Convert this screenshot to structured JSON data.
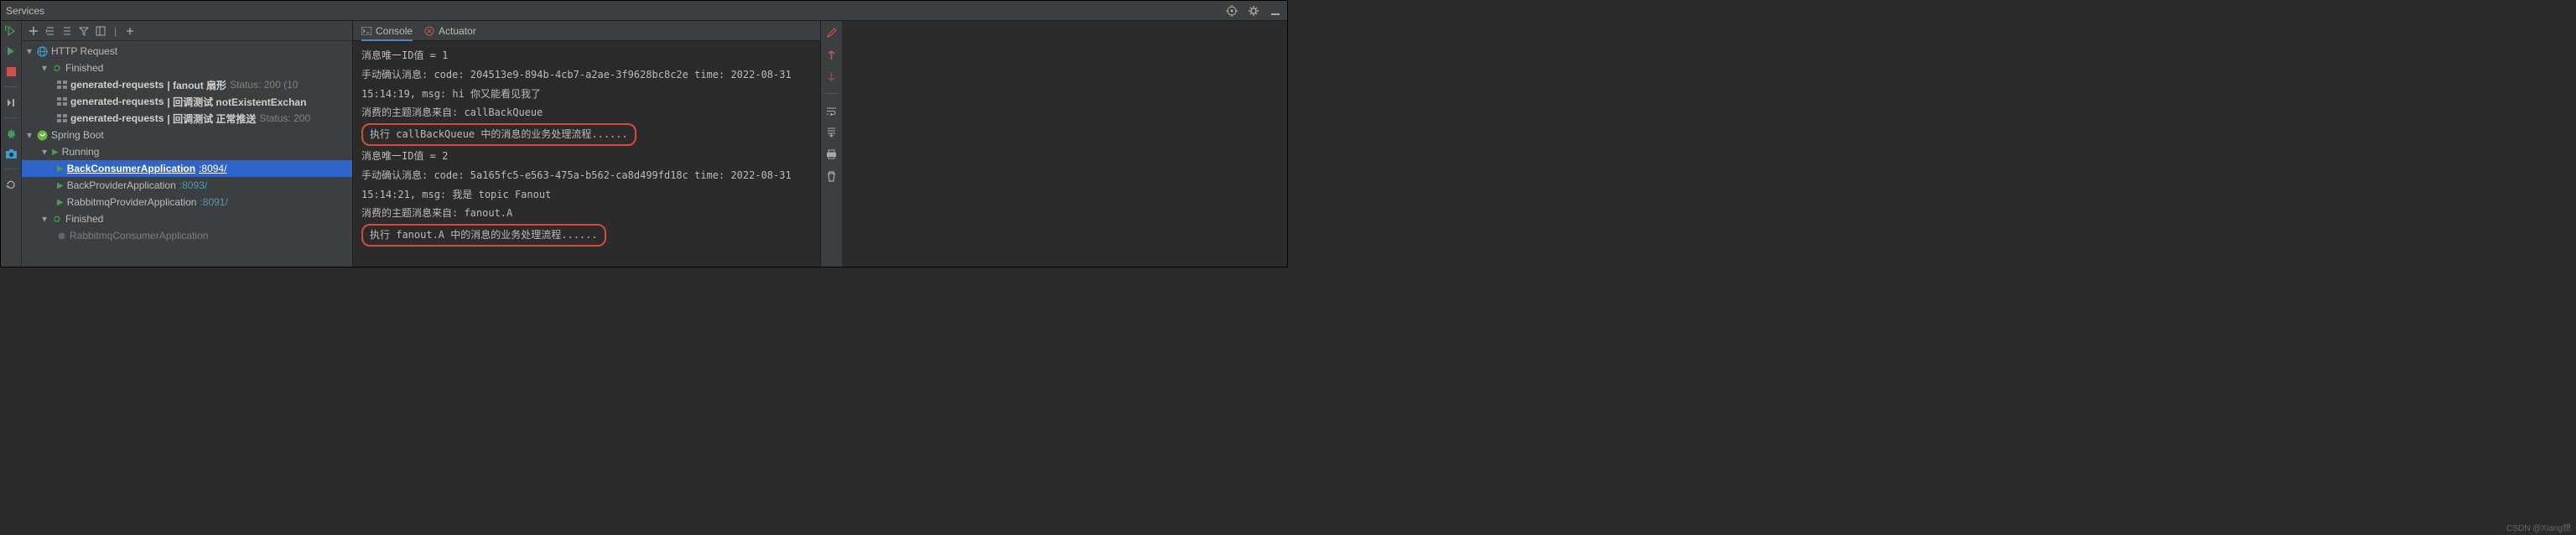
{
  "header": {
    "title": "Services"
  },
  "tree": {
    "http_request": "HTTP Request",
    "finished": "Finished",
    "items_http": [
      {
        "name": "generated-requests",
        "suffix": " |  fanout 扇形",
        "status": "Status: 200 (10"
      },
      {
        "name": "generated-requests",
        "suffix": " |  回调测试 notExistentExchan"
      },
      {
        "name": "generated-requests",
        "suffix": " |  回调测试 正常推送",
        "status": "Status: 200"
      }
    ],
    "spring_boot": "Spring Boot",
    "running": "Running",
    "apps": [
      {
        "name": "BackConsumerApplication",
        "port": ":8094/"
      },
      {
        "name": "BackProviderApplication",
        "port": ":8093/"
      },
      {
        "name": "RabbitmqProviderApplication",
        "port": ":8091/"
      }
    ],
    "finished_app": "RabbitmqConsumerApplication"
  },
  "tabs": {
    "console": "Console",
    "actuator": "Actuator"
  },
  "console": {
    "line1": "消息唯一ID值 = 1",
    "line2": "手动确认消息: code: 204513e9-894b-4cb7-a2ae-3f9628bc8c2e time: 2022-08-31 15:14:19, msg: hi 你又能看见我了",
    "line3": "消费的主题消息来自: callBackQueue",
    "line4": "执行 callBackQueue 中的消息的业务处理流程......",
    "line5": "消息唯一ID值 = 2",
    "line6": "手动确认消息: code: 5a165fc5-e563-475a-b562-ca8d499fd18c time: 2022-08-31 15:14:21, msg: 我是 topic Fanout",
    "line7": "消费的主题消息来自: fanout.A",
    "line8": "执行 fanout.A 中的消息的业务处理流程......"
  },
  "watermark": "CSDN @Xiang想"
}
